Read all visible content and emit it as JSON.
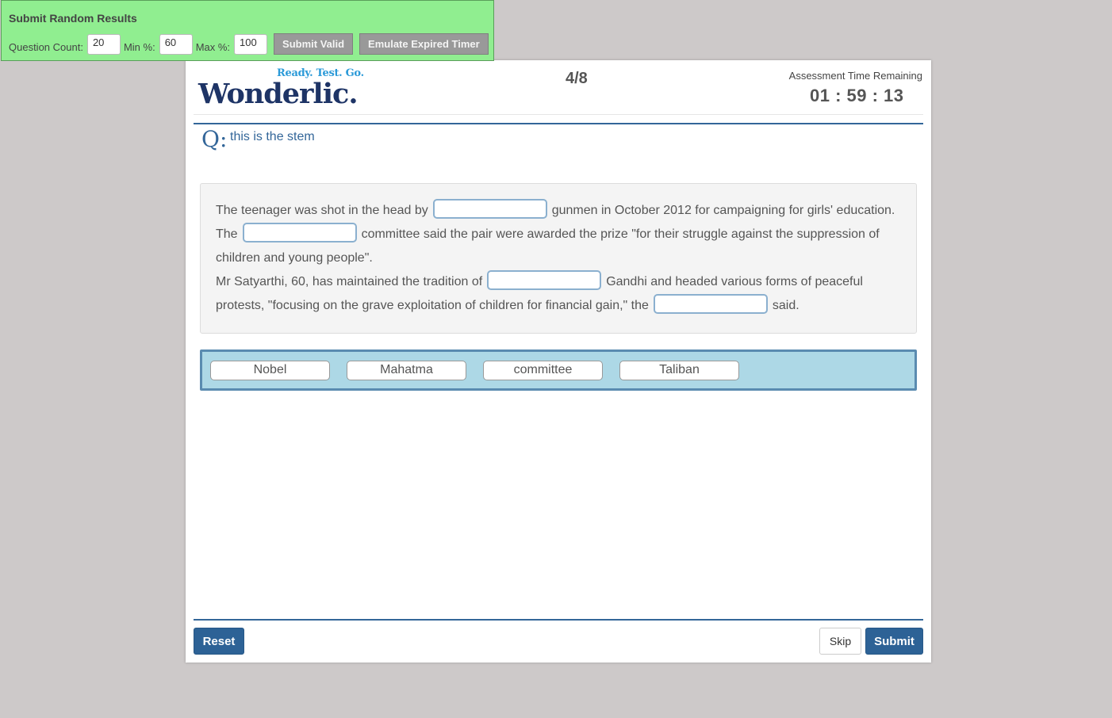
{
  "debug_panel": {
    "title": "Submit Random Results",
    "question_count_label": "Question Count:",
    "question_count_value": "20",
    "min_label": "Min %:",
    "min_value": "60",
    "max_label": "Max %:",
    "max_value": "100",
    "submit_valid_label": "Submit Valid",
    "emulate_expired_label": "Emulate Expired Timer"
  },
  "header": {
    "logo_tagline": "Ready. Test. Go.",
    "logo_wordmark": "Wonderlic.",
    "progress": "4/8",
    "timer_label": "Assessment Time Remaining",
    "timer_value": "01 : 59 : 13"
  },
  "question": {
    "q_mark": "Q:",
    "stem": "this is the stem"
  },
  "passage": {
    "segments": [
      "The teenager was shot in the head by",
      "gunmen in October 2012 for campaigning for girls' education. The",
      "committee said the pair were awarded the prize \"for their struggle against the suppression of children and young people\".",
      "Mr Satyarthi, 60, has maintained the tradition of",
      "Gandhi and headed various forms of peaceful protests, \"focusing on the grave exploitation of children for financial gain,\" the",
      "said."
    ]
  },
  "word_bank": {
    "words": [
      "Nobel",
      "Mahatma",
      "committee",
      "Taliban"
    ]
  },
  "footer": {
    "reset_label": "Reset",
    "skip_label": "Skip",
    "submit_label": "Submit"
  }
}
